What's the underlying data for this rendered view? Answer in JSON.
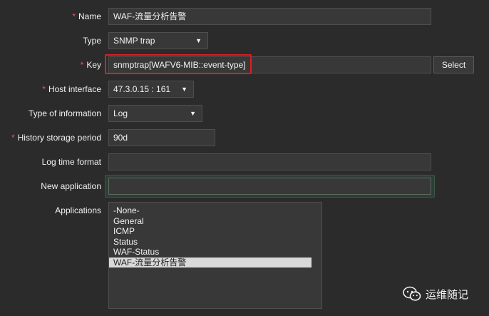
{
  "form": {
    "name": {
      "label": "Name",
      "required": true,
      "value": "WAF-流量分析告警"
    },
    "type": {
      "label": "Type",
      "value": "SNMP trap"
    },
    "key": {
      "label": "Key",
      "required": true,
      "value": "snmptrap[WAFV6-MIB::event-type]",
      "select_button": "Select"
    },
    "host_interface": {
      "label": "Host interface",
      "required": true,
      "value": "47.3.0.15 : 161"
    },
    "type_of_information": {
      "label": "Type of information",
      "value": "Log"
    },
    "history": {
      "label": "History storage period",
      "required": true,
      "value": "90d"
    },
    "log_time_format": {
      "label": "Log time format",
      "value": ""
    },
    "new_application": {
      "label": "New application",
      "value": ""
    },
    "applications": {
      "label": "Applications",
      "options": [
        "-None-",
        "General",
        "ICMP",
        "Status",
        "WAF-Status",
        "WAF-流量分析告警"
      ],
      "selected": "WAF-流量分析告警"
    }
  },
  "watermark": {
    "text": "运维随记",
    "icon": "wechat-icon"
  },
  "colors": {
    "background": "#2b2b2b",
    "required": "#e45959",
    "highlight": "#e11d1d"
  }
}
